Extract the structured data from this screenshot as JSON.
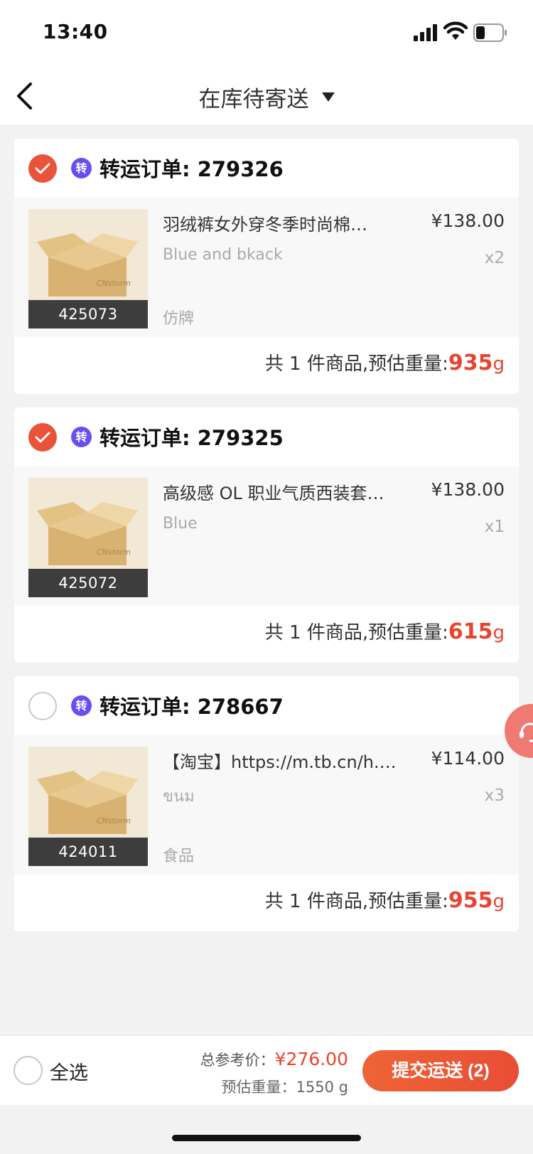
{
  "status_bar": {
    "time": "13:40"
  },
  "header": {
    "title": "在库待寄送"
  },
  "orders": [
    {
      "checked": true,
      "badge": "转",
      "title": "转运订单: 279326",
      "item": {
        "name": "羽绒裤女外穿冬季时尚棉…",
        "price": "¥138.00",
        "spec": "Blue and bkack",
        "qty": "x2",
        "tag": "仿牌",
        "image_code": "425073"
      },
      "summary_prefix": "共 1 件商品,预估重量:",
      "weight": "935",
      "weight_unit": "g"
    },
    {
      "checked": true,
      "badge": "转",
      "title": "转运订单: 279325",
      "item": {
        "name": "高级感 OL 职业气质西装套…",
        "price": "¥138.00",
        "spec": "Blue",
        "qty": "x1",
        "tag": "",
        "image_code": "425072"
      },
      "summary_prefix": "共 1 件商品,预估重量:",
      "weight": "615",
      "weight_unit": "g"
    },
    {
      "checked": false,
      "badge": "转",
      "title": "转运订单: 278667",
      "item": {
        "name": "【淘宝】https://m.tb.cn/h.…",
        "price": "¥114.00",
        "spec": "ขนม",
        "qty": "x3",
        "tag": "食品",
        "image_code": "424011"
      },
      "summary_prefix": "共 1 件商品,预估重量:",
      "weight": "955",
      "weight_unit": "g"
    }
  ],
  "footer": {
    "select_all_label": "全选",
    "total_label": "总参考价：",
    "total_amount": "¥276.00",
    "weight_line": "预估重量：1550 g",
    "submit_label": "提交运送 (2)"
  },
  "colors": {
    "accent": "#e8442f",
    "badge": "#6a4df3",
    "check": "#e9533a"
  },
  "icons": [
    "signal-icon",
    "wifi-icon",
    "battery-icon",
    "back-arrow-icon",
    "dropdown-caret-icon",
    "checkmark-icon",
    "customer-service-icon"
  ]
}
